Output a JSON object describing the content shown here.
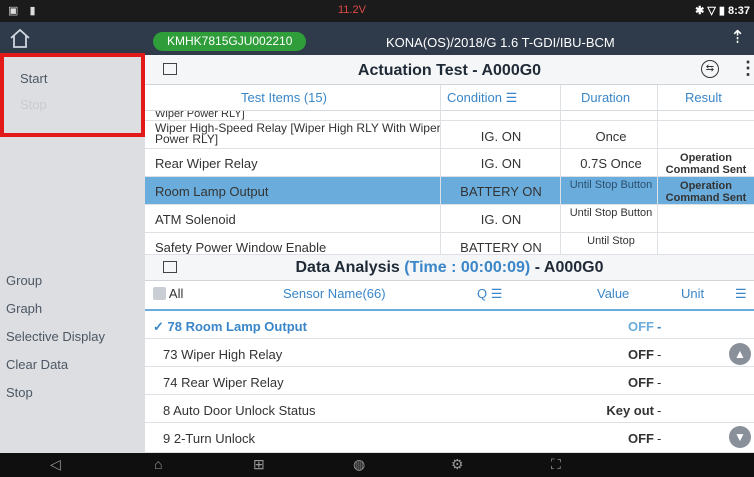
{
  "status": {
    "left": "▣ ▮",
    "voltage": "11.2V",
    "right": "✱ ▽ ▮ 8:37"
  },
  "header": {
    "vin": "KMHK7815GJU002210",
    "model": "KONA(OS)/2018/G 1.6 T-GDI/IBU-BCM",
    "home_icon": "home-icon",
    "up_icon": "up-arrow-icon"
  },
  "sidebar": {
    "top_items": [
      "Start",
      "Stop"
    ],
    "bottom_items": [
      "Group",
      "Graph",
      "Selective Display",
      "Clear Data",
      "Stop"
    ]
  },
  "actuation": {
    "title": "Actuation Test - A000G0",
    "columns": {
      "items": "Test Items (15)",
      "condition": "Condition",
      "duration": "Duration",
      "result": "Result"
    },
    "rows": [
      {
        "name": "Wiper Power RLY]",
        "condition": "",
        "duration": "",
        "result": ""
      },
      {
        "name": "Wiper High-Speed Relay [Wiper High RLY With Wiper Power RLY]",
        "condition": "IG. ON",
        "duration": "Once",
        "result": ""
      },
      {
        "name": "Rear Wiper Relay",
        "condition": "IG. ON",
        "duration": "0.7S Once",
        "result": "Operation Command Sent"
      },
      {
        "name": "Room Lamp Output",
        "condition": "BATTERY ON",
        "duration": "Until Stop Button",
        "result": "Operation Command Sent"
      },
      {
        "name": "ATM Solenoid",
        "condition": "IG. ON",
        "duration": "Until Stop Button",
        "result": ""
      },
      {
        "name": "Safety Power Window Enable",
        "condition": "BATTERY ON",
        "duration": "Until Stop",
        "result": ""
      }
    ]
  },
  "analysis": {
    "title_main": "Data Analysis",
    "title_time": "(Time : 00:00:09)",
    "title_code": "- A000G0",
    "columns": {
      "all": "All",
      "sensor": "Sensor Name(66)",
      "value": "Value",
      "unit": "Unit"
    },
    "rows": [
      {
        "name": "78 Room Lamp Output",
        "value": "OFF",
        "unit": "-"
      },
      {
        "name": "73 Wiper High Relay",
        "value": "OFF",
        "unit": "-"
      },
      {
        "name": "74 Rear Wiper Relay",
        "value": "OFF",
        "unit": "-"
      },
      {
        "name": "8 Auto Door Unlock Status",
        "value": "Key out",
        "unit": "-"
      },
      {
        "name": "9 2-Turn Unlock",
        "value": "OFF",
        "unit": "-"
      }
    ]
  },
  "navbar": {
    "icons": [
      "back-icon",
      "home-icon",
      "apps-icon",
      "globe-icon",
      "settings-icon",
      "screenshot-icon"
    ]
  },
  "colors": {
    "accent": "#3a86c8",
    "highlight": "#6aaddc",
    "vin_green": "#2f9d3a",
    "red_box": "#e11919"
  }
}
